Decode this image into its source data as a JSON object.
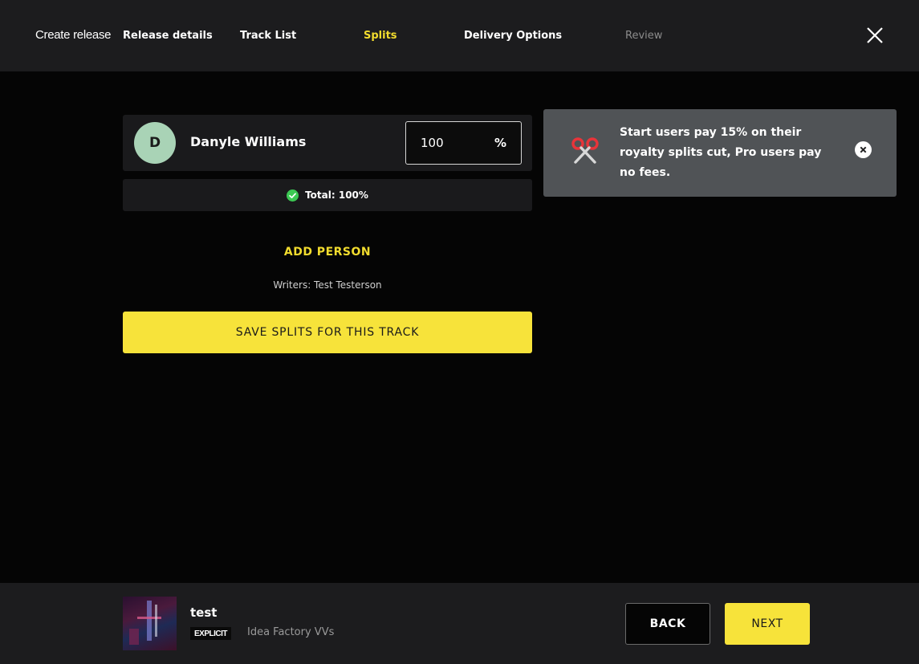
{
  "header": {
    "title": "Create release",
    "steps": [
      {
        "label": "Release details",
        "state": "done"
      },
      {
        "label": "Track List",
        "state": "done"
      },
      {
        "label": "Splits",
        "state": "active"
      },
      {
        "label": "Delivery Options",
        "state": "upcoming"
      },
      {
        "label": "Review",
        "state": "disabled"
      }
    ],
    "close_icon": "close-icon"
  },
  "splits": {
    "person": {
      "initial": "D",
      "name": "Danyle Williams",
      "percent_value": "100",
      "percent_sign": "%"
    },
    "total_text": "Total: 100%",
    "add_person_label": "ADD PERSON",
    "writers_text": "Writers: Test Testerson",
    "save_label": "SAVE SPLITS FOR THIS TRACK"
  },
  "info": {
    "icon": "scissors-icon",
    "text": "Start users pay 15% on their royalty splits cut, Pro users pay no fees."
  },
  "footer": {
    "track_title": "test",
    "explicit_label": "EXPLICIT",
    "artist": "Idea Factory VVs",
    "back_label": "BACK",
    "next_label": "NEXT"
  },
  "colors": {
    "accent": "#f7e33a",
    "active_step": "#f2dc2e",
    "check_green": "#3cc853",
    "scissors_red": "#e8343a"
  }
}
